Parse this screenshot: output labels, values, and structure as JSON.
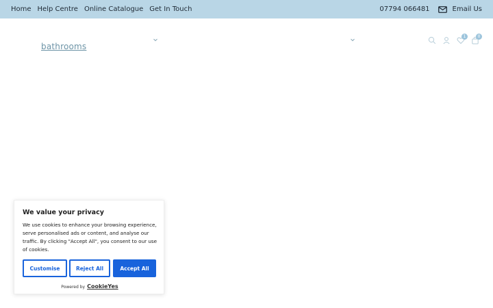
{
  "topbar": {
    "nav": [
      "Home",
      "Help Centre",
      "Online Catalogue",
      "Get In Touch"
    ],
    "phone": "07794 066481",
    "email_label": "Email Us"
  },
  "header": {
    "logo_text": "bathrooms",
    "wishlist_count": "1",
    "cart_count": "0"
  },
  "cookie_banner": {
    "title": "We value your privacy",
    "body": "We use cookies to enhance your browsing experience, serve personalised ads or content, and analyse our traffic. By clicking \"Accept All\", you consent to our use of cookies.",
    "customise_label": "Customise",
    "reject_label": "Reject All",
    "accept_label": "Accept All",
    "powered_by": "Powered by",
    "brand": "CookieYes"
  },
  "colors": {
    "topbar_bg": "#b9d6e6",
    "accent": "#1863dc",
    "logo": "#6c93a6"
  }
}
